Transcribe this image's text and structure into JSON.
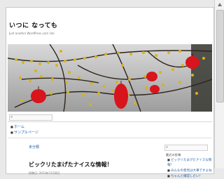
{
  "site": {
    "title": "いつに なっても",
    "description": "Just another WordPress.com site"
  },
  "header_image": {
    "name": "red-lanterns-and-blossoms",
    "colors": {
      "lantern": "#d8141c",
      "blossom": "#d8b21f",
      "branch": "#2d241c"
    }
  },
  "search": {
    "placeholder": ""
  },
  "nav": {
    "items": [
      {
        "label": "ホーム"
      },
      {
        "label": "サンプルページ"
      }
    ]
  },
  "post": {
    "category": "未分類",
    "title": "ビックリたまげたナイスな情報！",
    "meta": "投稿日: 2013年11月8日"
  },
  "sidebar": {
    "search_placeholder": "",
    "heading": "最近の投稿",
    "items": [
      {
        "label": "ビックリたまげたナイスな情報！"
      },
      {
        "label": "みんなの意見は大事ですよね"
      },
      {
        "label": "ちゃんと確認したい！"
      }
    ]
  }
}
